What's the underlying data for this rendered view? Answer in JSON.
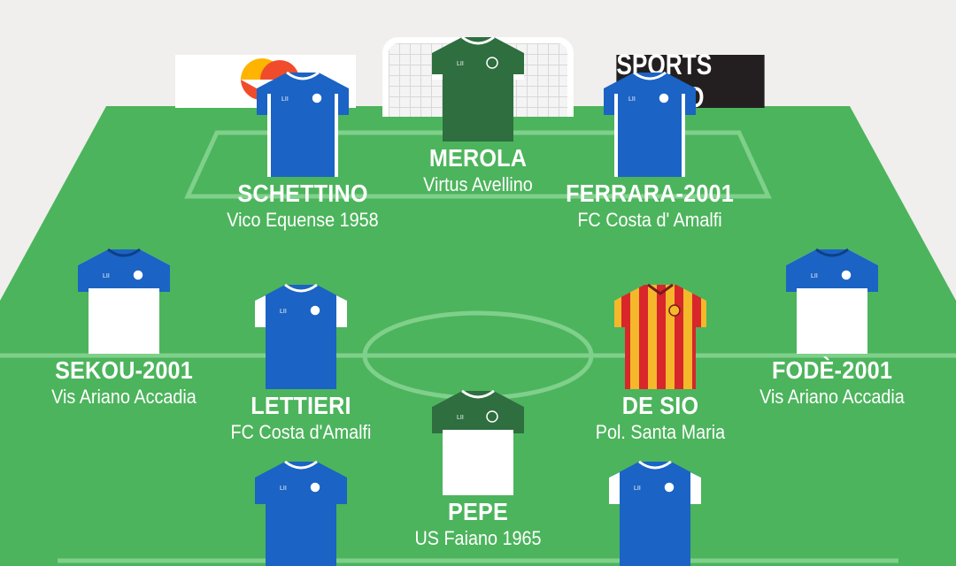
{
  "colors": {
    "grass": "#4cb45c",
    "lines": "#7fd08b",
    "background": "#f0efed"
  },
  "sponsors": {
    "right_text": "SPORTS STUDIO"
  },
  "players": [
    {
      "name": "MEROLA",
      "club": "Virtus Avellino",
      "kit": "green-goalkeeper"
    },
    {
      "name": "SCHETTINO",
      "club": "Vico Equense 1958",
      "kit": "blue"
    },
    {
      "name": "FERRARA-2001",
      "club": "FC Costa d' Amalfi",
      "kit": "blue"
    },
    {
      "name": "SEKOU-2001",
      "club": "Vis Ariano Accadia",
      "kit": "blue-white"
    },
    {
      "name": "LETTIERI",
      "club": "FC Costa d'Amalfi",
      "kit": "blue"
    },
    {
      "name": "DE SIO",
      "club": "Pol. Santa Maria",
      "kit": "red-yellow-stripes"
    },
    {
      "name": "FODÈ-2001",
      "club": "Vis Ariano Accadia",
      "kit": "blue-white"
    },
    {
      "name": "PEPE",
      "club": "US Faiano 1965",
      "kit": "green-white"
    },
    {
      "name": "",
      "club": "",
      "kit": "blue"
    },
    {
      "name": "",
      "club": "",
      "kit": "blue"
    }
  ]
}
